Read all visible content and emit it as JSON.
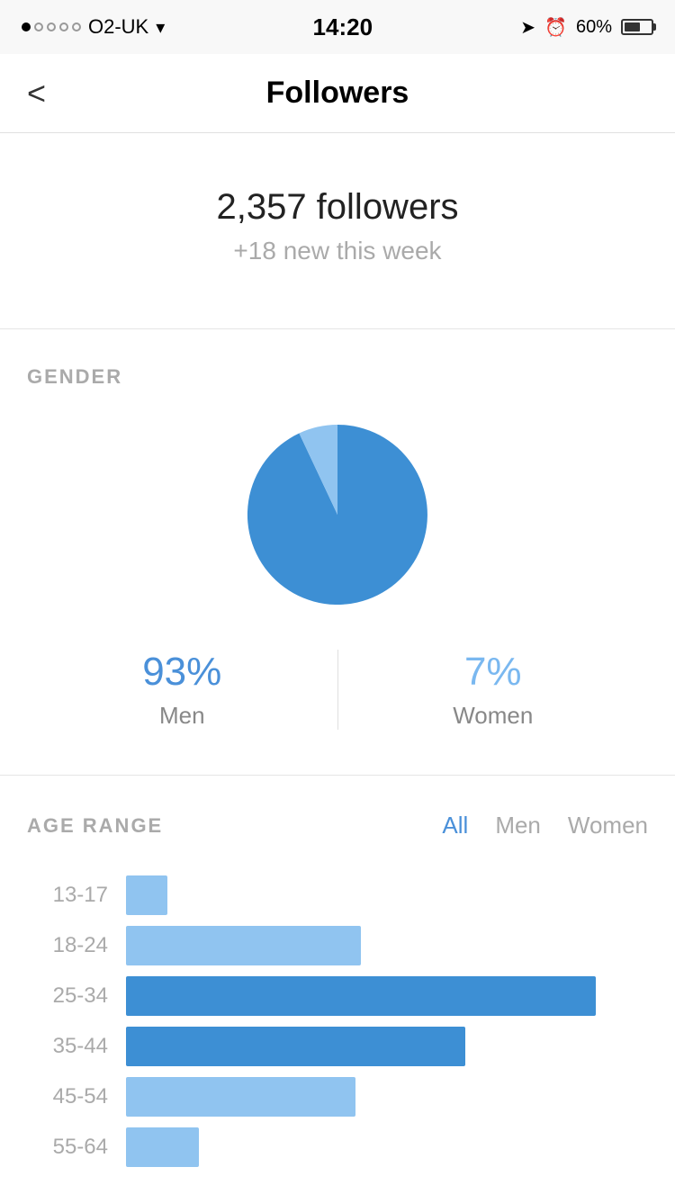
{
  "statusBar": {
    "carrier": "O2-UK",
    "time": "14:20",
    "battery": "60%"
  },
  "nav": {
    "title": "Followers",
    "backLabel": "<"
  },
  "followers": {
    "count": "2,357 followers",
    "newThisWeek": "+18 new this week"
  },
  "gender": {
    "sectionLabel": "GENDER",
    "menPct": "93%",
    "menLabel": "Men",
    "womenPct": "7%",
    "womenLabel": "Women",
    "menValue": 93,
    "womenValue": 7
  },
  "ageRange": {
    "sectionLabel": "AGE RANGE",
    "filters": [
      {
        "label": "All",
        "active": true
      },
      {
        "label": "Men",
        "active": false
      },
      {
        "label": "Women",
        "active": false
      }
    ],
    "bars": [
      {
        "range": "13-17",
        "pct": 8,
        "style": "light"
      },
      {
        "range": "18-24",
        "pct": 45,
        "style": "light"
      },
      {
        "range": "25-34",
        "pct": 90,
        "style": "dark"
      },
      {
        "range": "35-44",
        "pct": 65,
        "style": "dark"
      },
      {
        "range": "45-54",
        "pct": 44,
        "style": "light"
      },
      {
        "range": "55-64",
        "pct": 14,
        "style": "light"
      }
    ]
  }
}
